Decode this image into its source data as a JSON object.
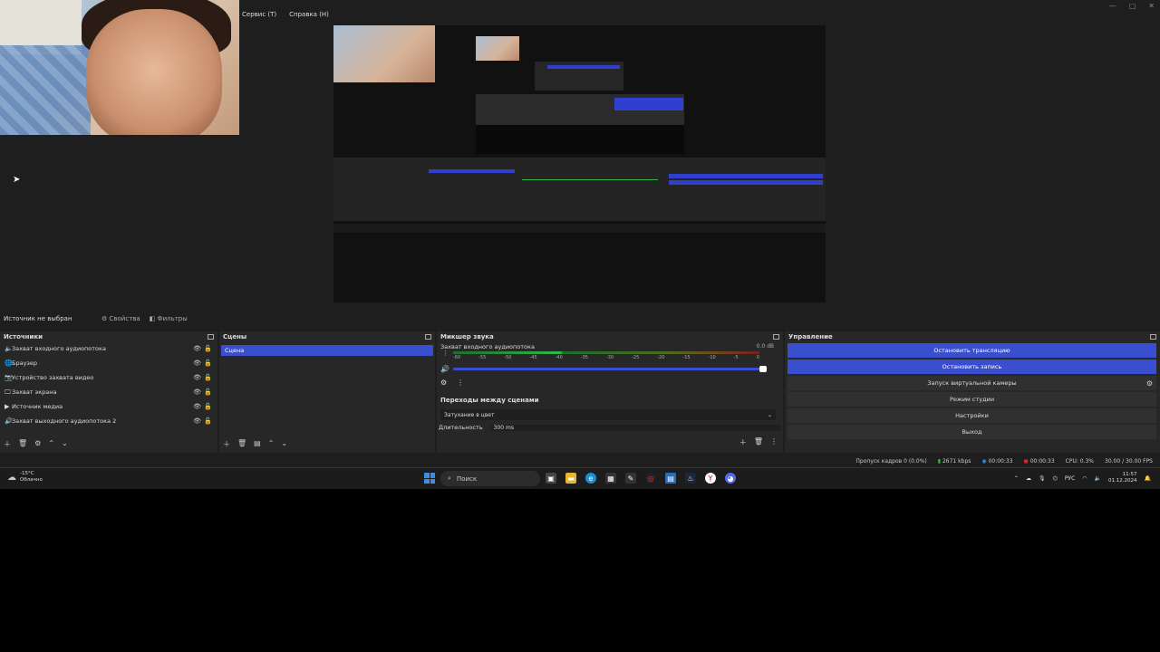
{
  "menu": {
    "items": [
      "Сервис (T)",
      "Справка (H)"
    ]
  },
  "source_bar": {
    "label": "Источник не выбран",
    "properties": "Свойства",
    "filters": "Фильтры"
  },
  "sources": {
    "title": "Источники",
    "items": [
      {
        "label": "Захват входного аудиопотока",
        "icon": "🔈"
      },
      {
        "label": "Браузер",
        "icon": "🌐"
      },
      {
        "label": "Устройство захвата видео",
        "icon": "📷"
      },
      {
        "label": "Захват экрана",
        "icon": "🖵"
      },
      {
        "label": "Источник медиа",
        "icon": "▶"
      },
      {
        "label": "Захват выходного аудиопотока 2",
        "icon": "🔊"
      }
    ]
  },
  "scenes": {
    "title": "Сцены",
    "selected": "Сцена"
  },
  "mixer": {
    "title": "Микшер звука",
    "track_label": "Захват входного аудиопотока",
    "db": "0.0 dB",
    "ticks": [
      "-60",
      "-55",
      "-50",
      "-45",
      "-40",
      "-35",
      "-30",
      "-25",
      "-20",
      "-15",
      "-10",
      "-5",
      "0"
    ]
  },
  "transitions": {
    "title": "Переходы между сценами",
    "selected": "Затухание в цвет",
    "duration_label": "Длительность",
    "duration_value": "300 ms"
  },
  "controls": {
    "title": "Управление",
    "buttons": [
      {
        "label": "Остановить трансляцию",
        "active": true
      },
      {
        "label": "Остановить запись",
        "active": true
      },
      {
        "label": "Запуск виртуальной камеры",
        "active": false
      },
      {
        "label": "Режим студии",
        "active": false
      },
      {
        "label": "Настройки",
        "active": false
      },
      {
        "label": "Выход",
        "active": false
      }
    ]
  },
  "status": {
    "dropped": "Пропуск кадров 0 (0.0%)",
    "bitrate": "2671 kbps",
    "stream_time": "00:00:33",
    "rec_time": "00:00:33",
    "cpu": "CPU: 0.3%",
    "fps": "30.00 / 30.00 FPS"
  },
  "taskbar": {
    "weather_temp": "-15°C",
    "weather_desc": "Облачно",
    "search_label": "Поиск",
    "lang": "РУС",
    "time": "11:57",
    "date": "01.12.2024"
  },
  "colors": {
    "accent": "#3a4fcf",
    "panel": "#272727",
    "background": "#1e1e1e"
  }
}
